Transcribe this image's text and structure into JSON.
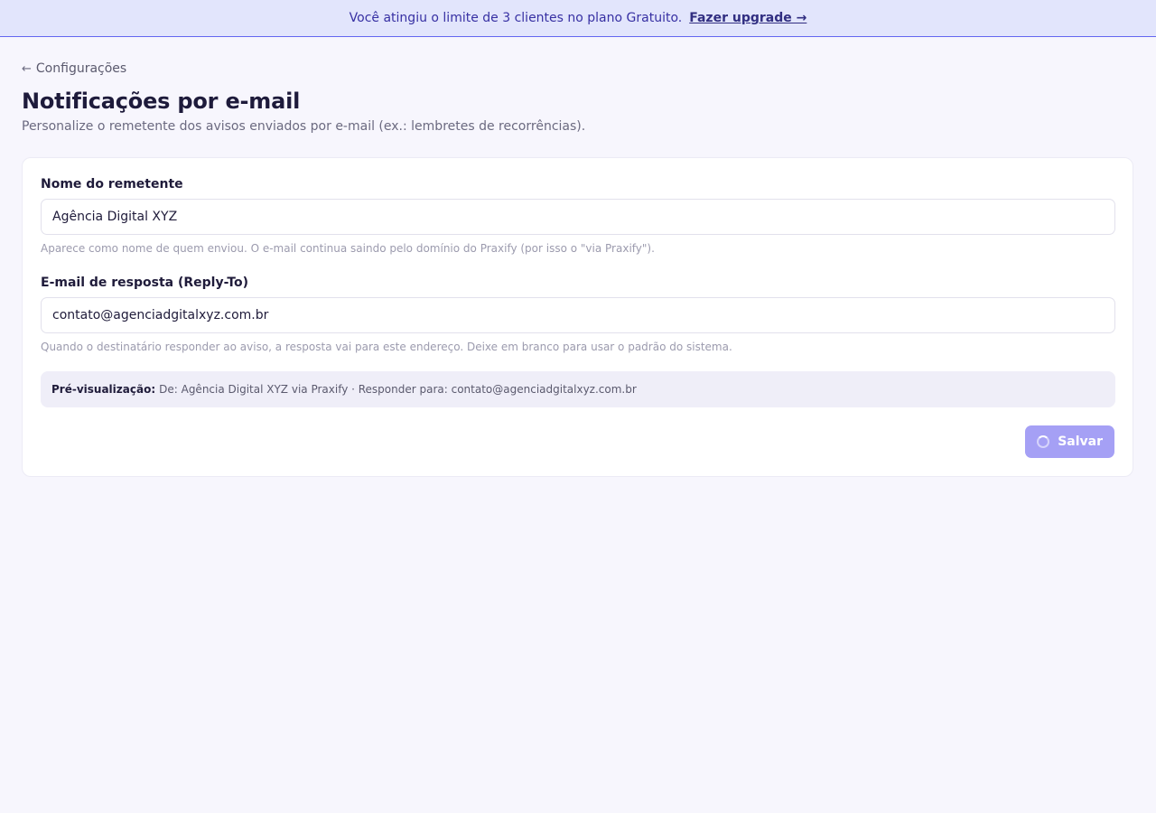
{
  "banner": {
    "message": "Você atingiu o limite de 3 clientes no plano Gratuito.",
    "upgrade_link": "Fazer upgrade →"
  },
  "nav": {
    "back_label": "Configurações"
  },
  "header": {
    "title": "Notificações por e-mail",
    "subtitle": "Personalize o remetente dos avisos enviados por e-mail (ex.: lembretes de recorrências)."
  },
  "form": {
    "sender_name": {
      "label": "Nome do remetente",
      "value": "Agência Digital XYZ",
      "hint": "Aparece como nome de quem enviou. O e-mail continua saindo pelo domínio do Praxify (por isso o \"via Praxify\")."
    },
    "reply_to": {
      "label": "E-mail de resposta (Reply-To)",
      "value": "contato@agenciadgitalxyz.com.br",
      "hint": "Quando o destinatário responder ao aviso, a resposta vai para este endereço. Deixe em branco para usar o padrão do sistema."
    },
    "preview": {
      "label": "Pré-visualização:",
      "text": "De: Agência Digital XYZ via Praxify · Responder para: contato@agenciadgitalxyz.com.br"
    },
    "save_label": "Salvar"
  },
  "colors": {
    "banner_bg": "#e2e5fc",
    "accent": "#6366f1",
    "save_button_loading": "#a5a0f5"
  }
}
